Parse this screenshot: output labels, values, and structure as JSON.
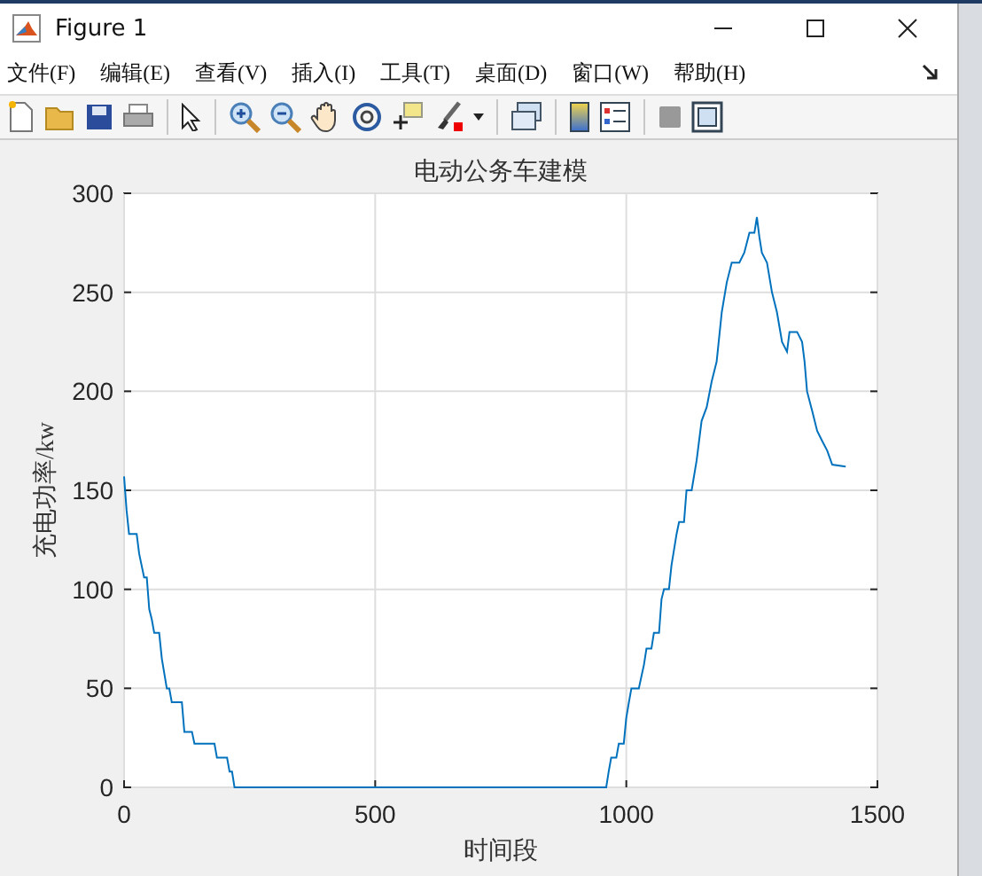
{
  "window": {
    "title": "Figure 1"
  },
  "menu": [
    {
      "label": "文件(F)"
    },
    {
      "label": "编辑(E)"
    },
    {
      "label": "查看(V)"
    },
    {
      "label": "插入(I)"
    },
    {
      "label": "工具(T)"
    },
    {
      "label": "桌面(D)"
    },
    {
      "label": "窗口(W)"
    },
    {
      "label": "帮助(H)"
    }
  ],
  "chart_data": {
    "type": "line",
    "title": "电动公务车建模",
    "xlabel": "时间段",
    "ylabel": "充电功率/kw",
    "x": [
      0,
      5,
      10,
      25,
      30,
      40,
      45,
      50,
      55,
      60,
      70,
      75,
      85,
      90,
      95,
      115,
      120,
      135,
      140,
      180,
      185,
      205,
      210,
      215,
      220,
      960,
      965,
      970,
      980,
      985,
      995,
      1000,
      1005,
      1010,
      1025,
      1035,
      1040,
      1050,
      1055,
      1065,
      1070,
      1075,
      1085,
      1090,
      1100,
      1105,
      1115,
      1120,
      1130,
      1140,
      1150,
      1160,
      1170,
      1180,
      1190,
      1200,
      1210,
      1225,
      1235,
      1245,
      1255,
      1260,
      1265,
      1270,
      1280,
      1290,
      1300,
      1310,
      1320,
      1325,
      1340,
      1350,
      1355,
      1360,
      1370,
      1380,
      1390,
      1400,
      1410,
      1437
    ],
    "series": [
      {
        "color": "#0072bd",
        "values": [
          157,
          140,
          128,
          128,
          118,
          106,
          106,
          90,
          85,
          78,
          78,
          65,
          50,
          50,
          43,
          43,
          28,
          28,
          22,
          22,
          15,
          15,
          8,
          8,
          0,
          0,
          8,
          15,
          15,
          22,
          22,
          35,
          43,
          50,
          50,
          62,
          70,
          70,
          78,
          78,
          95,
          100,
          100,
          112,
          128,
          134,
          134,
          150,
          150,
          165,
          185,
          192,
          205,
          215,
          240,
          255,
          265,
          265,
          270,
          280,
          280,
          288,
          278,
          270,
          265,
          250,
          240,
          225,
          220,
          230,
          230,
          225,
          215,
          200,
          190,
          180,
          175,
          170,
          163,
          162
        ]
      }
    ],
    "xlim": [
      0,
      1500
    ],
    "ylim": [
      0,
      300
    ],
    "xticks": [
      0,
      500,
      1000,
      1500
    ],
    "yticks": [
      0,
      50,
      100,
      150,
      200,
      250,
      300
    ],
    "grid": true
  }
}
